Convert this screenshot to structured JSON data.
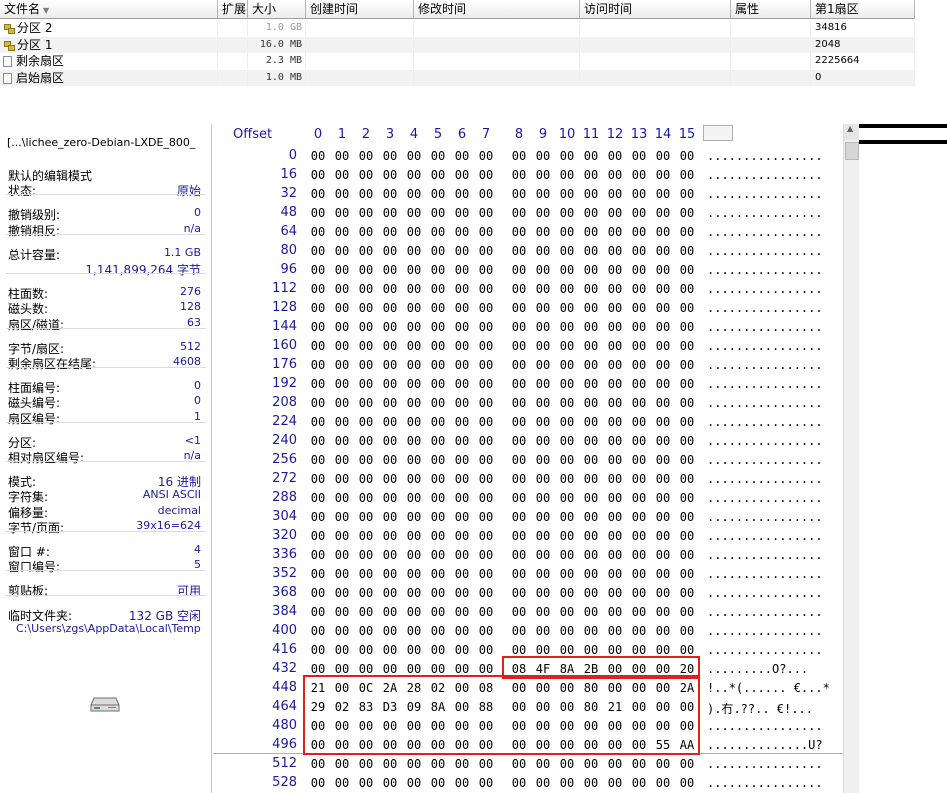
{
  "file_list": {
    "columns": [
      "文件名",
      "扩展名",
      "大小",
      "创建时间",
      "修改时间",
      "访问时间",
      "属性",
      "第1扇区"
    ],
    "sort_indicator": "▼",
    "rows": [
      {
        "icon": "partition-icon",
        "name": "分区 2",
        "ext": "",
        "size": "1.0 GB",
        "size_dim": true,
        "created": "",
        "modified": "",
        "accessed": "",
        "attr": "",
        "first_sector": "34816"
      },
      {
        "icon": "partition-icon",
        "name": "分区 1",
        "ext": "",
        "size": "16.0 MB",
        "size_dim": false,
        "created": "",
        "modified": "",
        "accessed": "",
        "attr": "",
        "first_sector": "2048"
      },
      {
        "icon": "file-icon",
        "name": "剩余扇区",
        "ext": "",
        "size": "2.3 MB",
        "size_dim": false,
        "created": "",
        "modified": "",
        "accessed": "",
        "attr": "",
        "first_sector": "2225664"
      },
      {
        "icon": "file-icon",
        "name": "启始扇区",
        "ext": "",
        "size": "1.0 MB",
        "size_dim": false,
        "created": "",
        "modified": "",
        "accessed": "",
        "attr": "",
        "first_sector": "0"
      }
    ]
  },
  "info_panel": {
    "path": "[...\\lichee_zero-Debian-LXDE_800_",
    "groups": [
      [
        {
          "label": "默认的编辑模式",
          "value": ""
        },
        {
          "label": "状态:",
          "value": "原始"
        }
      ],
      [
        {
          "label": "撤销级别:",
          "value": "0"
        },
        {
          "label": "撤销相反:",
          "value": "n/a"
        }
      ],
      [
        {
          "label": "总计容量:",
          "value": "1.1 GB"
        },
        {
          "label": "",
          "value": "1,141,899,264 字节"
        }
      ],
      [
        {
          "label": "柱面数:",
          "value": "276"
        },
        {
          "label": "磁头数:",
          "value": "128"
        },
        {
          "label": "扇区/磁道:",
          "value": "63"
        }
      ],
      [
        {
          "label": "字节/扇区:",
          "value": "512"
        },
        {
          "label": "剩余扇区在结尾:",
          "value": "4608"
        }
      ],
      [
        {
          "label": "柱面编号:",
          "value": "0"
        },
        {
          "label": "磁头编号:",
          "value": "0"
        },
        {
          "label": "扇区编号:",
          "value": "1"
        }
      ],
      [
        {
          "label": "分区:",
          "value": "<1"
        },
        {
          "label": "相对扇区编号:",
          "value": "n/a"
        }
      ],
      [
        {
          "label": "模式:",
          "value": "16 进制"
        },
        {
          "label": "字符集:",
          "value": "ANSI ASCII"
        },
        {
          "label": "偏移量:",
          "value": "decimal"
        },
        {
          "label": "字节/页面:",
          "value": "39x16=624"
        }
      ],
      [
        {
          "label": "窗口 #:",
          "value": "4"
        },
        {
          "label": "窗口编号:",
          "value": "5"
        }
      ],
      [
        {
          "label": "剪贴板:",
          "value": "可用"
        }
      ],
      [
        {
          "label": "临时文件夹:",
          "value": "132 GB 空闲"
        }
      ]
    ],
    "temp_path": "C:\\Users\\zgs\\AppData\\Local\\Temp",
    "icon": "disk-drive-icon"
  },
  "hex_view": {
    "offset_label": "Offset",
    "column_headers": [
      "0",
      "1",
      "2",
      "3",
      "4",
      "5",
      "6",
      "7",
      "8",
      "9",
      "10",
      "11",
      "12",
      "13",
      "14",
      "15"
    ],
    "rows": [
      {
        "offset": "0",
        "bytes": [
          "00",
          "00",
          "00",
          "00",
          "00",
          "00",
          "00",
          "00",
          "00",
          "00",
          "00",
          "00",
          "00",
          "00",
          "00",
          "00"
        ],
        "ascii": "................"
      },
      {
        "offset": "16",
        "bytes": [
          "00",
          "00",
          "00",
          "00",
          "00",
          "00",
          "00",
          "00",
          "00",
          "00",
          "00",
          "00",
          "00",
          "00",
          "00",
          "00"
        ],
        "ascii": "................"
      },
      {
        "offset": "32",
        "bytes": [
          "00",
          "00",
          "00",
          "00",
          "00",
          "00",
          "00",
          "00",
          "00",
          "00",
          "00",
          "00",
          "00",
          "00",
          "00",
          "00"
        ],
        "ascii": "................"
      },
      {
        "offset": "48",
        "bytes": [
          "00",
          "00",
          "00",
          "00",
          "00",
          "00",
          "00",
          "00",
          "00",
          "00",
          "00",
          "00",
          "00",
          "00",
          "00",
          "00"
        ],
        "ascii": "................"
      },
      {
        "offset": "64",
        "bytes": [
          "00",
          "00",
          "00",
          "00",
          "00",
          "00",
          "00",
          "00",
          "00",
          "00",
          "00",
          "00",
          "00",
          "00",
          "00",
          "00"
        ],
        "ascii": "................"
      },
      {
        "offset": "80",
        "bytes": [
          "00",
          "00",
          "00",
          "00",
          "00",
          "00",
          "00",
          "00",
          "00",
          "00",
          "00",
          "00",
          "00",
          "00",
          "00",
          "00"
        ],
        "ascii": "................"
      },
      {
        "offset": "96",
        "bytes": [
          "00",
          "00",
          "00",
          "00",
          "00",
          "00",
          "00",
          "00",
          "00",
          "00",
          "00",
          "00",
          "00",
          "00",
          "00",
          "00"
        ],
        "ascii": "................"
      },
      {
        "offset": "112",
        "bytes": [
          "00",
          "00",
          "00",
          "00",
          "00",
          "00",
          "00",
          "00",
          "00",
          "00",
          "00",
          "00",
          "00",
          "00",
          "00",
          "00"
        ],
        "ascii": "................"
      },
      {
        "offset": "128",
        "bytes": [
          "00",
          "00",
          "00",
          "00",
          "00",
          "00",
          "00",
          "00",
          "00",
          "00",
          "00",
          "00",
          "00",
          "00",
          "00",
          "00"
        ],
        "ascii": "................"
      },
      {
        "offset": "144",
        "bytes": [
          "00",
          "00",
          "00",
          "00",
          "00",
          "00",
          "00",
          "00",
          "00",
          "00",
          "00",
          "00",
          "00",
          "00",
          "00",
          "00"
        ],
        "ascii": "................"
      },
      {
        "offset": "160",
        "bytes": [
          "00",
          "00",
          "00",
          "00",
          "00",
          "00",
          "00",
          "00",
          "00",
          "00",
          "00",
          "00",
          "00",
          "00",
          "00",
          "00"
        ],
        "ascii": "................"
      },
      {
        "offset": "176",
        "bytes": [
          "00",
          "00",
          "00",
          "00",
          "00",
          "00",
          "00",
          "00",
          "00",
          "00",
          "00",
          "00",
          "00",
          "00",
          "00",
          "00"
        ],
        "ascii": "................"
      },
      {
        "offset": "192",
        "bytes": [
          "00",
          "00",
          "00",
          "00",
          "00",
          "00",
          "00",
          "00",
          "00",
          "00",
          "00",
          "00",
          "00",
          "00",
          "00",
          "00"
        ],
        "ascii": "................"
      },
      {
        "offset": "208",
        "bytes": [
          "00",
          "00",
          "00",
          "00",
          "00",
          "00",
          "00",
          "00",
          "00",
          "00",
          "00",
          "00",
          "00",
          "00",
          "00",
          "00"
        ],
        "ascii": "................"
      },
      {
        "offset": "224",
        "bytes": [
          "00",
          "00",
          "00",
          "00",
          "00",
          "00",
          "00",
          "00",
          "00",
          "00",
          "00",
          "00",
          "00",
          "00",
          "00",
          "00"
        ],
        "ascii": "................"
      },
      {
        "offset": "240",
        "bytes": [
          "00",
          "00",
          "00",
          "00",
          "00",
          "00",
          "00",
          "00",
          "00",
          "00",
          "00",
          "00",
          "00",
          "00",
          "00",
          "00"
        ],
        "ascii": "................"
      },
      {
        "offset": "256",
        "bytes": [
          "00",
          "00",
          "00",
          "00",
          "00",
          "00",
          "00",
          "00",
          "00",
          "00",
          "00",
          "00",
          "00",
          "00",
          "00",
          "00"
        ],
        "ascii": "................"
      },
      {
        "offset": "272",
        "bytes": [
          "00",
          "00",
          "00",
          "00",
          "00",
          "00",
          "00",
          "00",
          "00",
          "00",
          "00",
          "00",
          "00",
          "00",
          "00",
          "00"
        ],
        "ascii": "................"
      },
      {
        "offset": "288",
        "bytes": [
          "00",
          "00",
          "00",
          "00",
          "00",
          "00",
          "00",
          "00",
          "00",
          "00",
          "00",
          "00",
          "00",
          "00",
          "00",
          "00"
        ],
        "ascii": "................"
      },
      {
        "offset": "304",
        "bytes": [
          "00",
          "00",
          "00",
          "00",
          "00",
          "00",
          "00",
          "00",
          "00",
          "00",
          "00",
          "00",
          "00",
          "00",
          "00",
          "00"
        ],
        "ascii": "................"
      },
      {
        "offset": "320",
        "bytes": [
          "00",
          "00",
          "00",
          "00",
          "00",
          "00",
          "00",
          "00",
          "00",
          "00",
          "00",
          "00",
          "00",
          "00",
          "00",
          "00"
        ],
        "ascii": "................"
      },
      {
        "offset": "336",
        "bytes": [
          "00",
          "00",
          "00",
          "00",
          "00",
          "00",
          "00",
          "00",
          "00",
          "00",
          "00",
          "00",
          "00",
          "00",
          "00",
          "00"
        ],
        "ascii": "................"
      },
      {
        "offset": "352",
        "bytes": [
          "00",
          "00",
          "00",
          "00",
          "00",
          "00",
          "00",
          "00",
          "00",
          "00",
          "00",
          "00",
          "00",
          "00",
          "00",
          "00"
        ],
        "ascii": "................"
      },
      {
        "offset": "368",
        "bytes": [
          "00",
          "00",
          "00",
          "00",
          "00",
          "00",
          "00",
          "00",
          "00",
          "00",
          "00",
          "00",
          "00",
          "00",
          "00",
          "00"
        ],
        "ascii": "................"
      },
      {
        "offset": "384",
        "bytes": [
          "00",
          "00",
          "00",
          "00",
          "00",
          "00",
          "00",
          "00",
          "00",
          "00",
          "00",
          "00",
          "00",
          "00",
          "00",
          "00"
        ],
        "ascii": "................"
      },
      {
        "offset": "400",
        "bytes": [
          "00",
          "00",
          "00",
          "00",
          "00",
          "00",
          "00",
          "00",
          "00",
          "00",
          "00",
          "00",
          "00",
          "00",
          "00",
          "00"
        ],
        "ascii": "................"
      },
      {
        "offset": "416",
        "bytes": [
          "00",
          "00",
          "00",
          "00",
          "00",
          "00",
          "00",
          "00",
          "00",
          "00",
          "00",
          "00",
          "00",
          "00",
          "00",
          "00"
        ],
        "ascii": "................"
      },
      {
        "offset": "432",
        "bytes": [
          "00",
          "00",
          "00",
          "00",
          "00",
          "00",
          "00",
          "00",
          "08",
          "4F",
          "8A",
          "2B",
          "00",
          "00",
          "00",
          "20"
        ],
        "ascii": ".........O?..."
      },
      {
        "offset": "448",
        "bytes": [
          "21",
          "00",
          "0C",
          "2A",
          "28",
          "02",
          "00",
          "08",
          "00",
          "00",
          "00",
          "80",
          "00",
          "00",
          "00",
          "2A"
        ],
        "ascii": "!..*(...... €...*"
      },
      {
        "offset": "464",
        "bytes": [
          "29",
          "02",
          "83",
          "D3",
          "09",
          "8A",
          "00",
          "88",
          "00",
          "00",
          "00",
          "80",
          "21",
          "00",
          "00",
          "00"
        ],
        "ascii": ").冇.??.. €!..."
      },
      {
        "offset": "480",
        "bytes": [
          "00",
          "00",
          "00",
          "00",
          "00",
          "00",
          "00",
          "00",
          "00",
          "00",
          "00",
          "00",
          "00",
          "00",
          "00",
          "00"
        ],
        "ascii": "................"
      },
      {
        "offset": "496",
        "bytes": [
          "00",
          "00",
          "00",
          "00",
          "00",
          "00",
          "00",
          "00",
          "00",
          "00",
          "00",
          "00",
          "00",
          "00",
          "55",
          "AA"
        ],
        "ascii": "..............U?"
      },
      {
        "offset": "512",
        "bytes": [
          "00",
          "00",
          "00",
          "00",
          "00",
          "00",
          "00",
          "00",
          "00",
          "00",
          "00",
          "00",
          "00",
          "00",
          "00",
          "00"
        ],
        "ascii": "................"
      },
      {
        "offset": "528",
        "bytes": [
          "00",
          "00",
          "00",
          "00",
          "00",
          "00",
          "00",
          "00",
          "00",
          "00",
          "00",
          "00",
          "00",
          "00",
          "00",
          "00"
        ],
        "ascii": "................"
      }
    ]
  },
  "colors": {
    "offset_blue": "#1a1aa0",
    "highlight_red": "#e0201a",
    "info_value_blue": "#1a1aa0"
  }
}
